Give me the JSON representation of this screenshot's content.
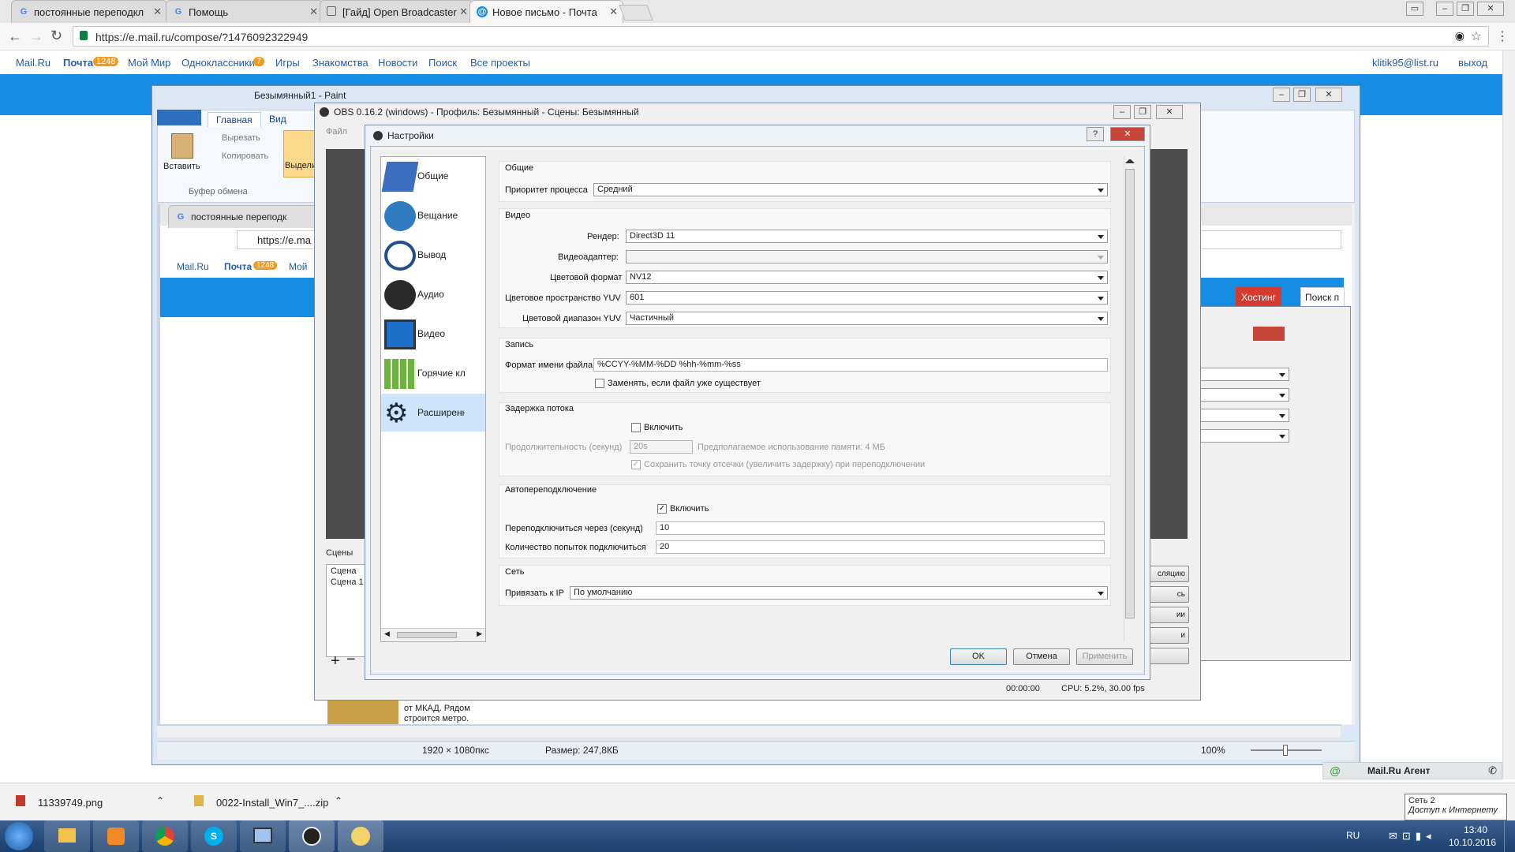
{
  "browser": {
    "tabs": [
      {
        "label": "постоянные переподкл",
        "icon": "google-icon"
      },
      {
        "label": "Помощь",
        "icon": "google-icon"
      },
      {
        "label": "[Гайд] Open Broadcaster",
        "icon": "page-icon"
      },
      {
        "label": "Новое письмо - Почта",
        "icon": "mailru-icon"
      }
    ],
    "url": "https://e.mail.ru/compose/?1476092322949",
    "user": "klitik95@list.ru",
    "logout": "выход"
  },
  "mailru_nav": {
    "items": [
      "Mail.Ru",
      "Почта",
      "Мой Мир",
      "Одноклассники",
      "Игры",
      "Знакомства",
      "Новости",
      "Поиск",
      "Все проекты"
    ],
    "pochta_badge": "1248",
    "ok_badge": "7"
  },
  "paint": {
    "title": "Безымянный1 - Paint",
    "tabs": [
      "Главная",
      "Вид"
    ],
    "paste": "Вставить",
    "cut": "Вырезать",
    "copy": "Копировать",
    "select": "Выдели",
    "clipboard_group": "Буфер обмена",
    "status_dims": "1920 × 1080пкс",
    "status_size": "Размер: 247,8КБ",
    "zoom": "100%"
  },
  "inner_browser": {
    "tab": "постоянные переподк",
    "url": "https://e.ma",
    "nav": [
      "Mail.Ru",
      "Почта",
      "Мой"
    ],
    "badge": "1248",
    "hosting": "Хостинг",
    "search": "Поиск п"
  },
  "thumb_text": "от МКАД. Рядом строится метро.",
  "obs": {
    "title": "OBS 0.16.2 (windows) - Профиль: Безымянный - Сцены: Безымянный",
    "menu_file": "Файл",
    "scenes_label": "Сцены",
    "scenes": [
      "Сцена",
      "Сцена 1"
    ],
    "time": "00:00:00",
    "cpu": "CPU: 5.2%, 30.00 fps",
    "side_buttons": [
      "сляцию",
      "сь",
      "ии",
      "и"
    ]
  },
  "settings": {
    "title": "Настройки",
    "nav": [
      "Общие",
      "Вещание",
      "Вывод",
      "Аудио",
      "Видео",
      "Горячие клав",
      "Расширенны"
    ],
    "selected": 6,
    "general": {
      "header": "Общие",
      "priority_label": "Приоритет процесса",
      "priority_value": "Средний"
    },
    "video": {
      "header": "Видео",
      "render_label": "Рендер:",
      "render_value": "Direct3D 11",
      "adapter_label": "Видеоадаптер:",
      "adapter_value": "",
      "format_label": "Цветовой формат",
      "format_value": "NV12",
      "yuv_space_label": "Цветовое пространство YUV",
      "yuv_space_value": "601",
      "yuv_range_label": "Цветовой диапазон YUV",
      "yuv_range_value": "Частичный"
    },
    "recording": {
      "header": "Запись",
      "filename_label": "Формат имени файла",
      "filename_value": "%CCYY-%MM-%DD %hh-%mm-%ss",
      "overwrite_label": "Заменять, если файл уже существует"
    },
    "delay": {
      "header": "Задержка потока",
      "enable_label": "Включить",
      "duration_label": "Продолжительность (секунд)",
      "duration_value": "20s",
      "memory_label": "Предполагаемое использование памяти: 4 МБ",
      "preserve_label": "Сохранить точку отсечки (увеличить задержку) при переподключении"
    },
    "reconnect": {
      "header": "Автопереподключение",
      "enable_label": "Включить",
      "delay_label": "Переподключиться через (секунд)",
      "delay_value": "10",
      "retries_label": "Количество попыток подключиться",
      "retries_value": "20"
    },
    "network": {
      "header": "Сеть",
      "bind_label": "Привязать к IP",
      "bind_value": "По умолчанию"
    },
    "ok": "OK",
    "cancel": "Отмена",
    "apply": "Применить",
    "help": "?"
  },
  "agent": "Mail.Ru Агент",
  "downloads": [
    {
      "name": "11339749.png"
    },
    {
      "name": "0022-Install_Win7_....zip"
    }
  ],
  "tooltip": {
    "line1": "Сеть  2",
    "line2": "Доступ к Интернету"
  },
  "taskbar": {
    "lang": "RU",
    "time": "13:40",
    "date": "10.10.2016"
  },
  "colors": {
    "mailru_blue": "#168de2",
    "taskbar": "#1c3f6e"
  }
}
